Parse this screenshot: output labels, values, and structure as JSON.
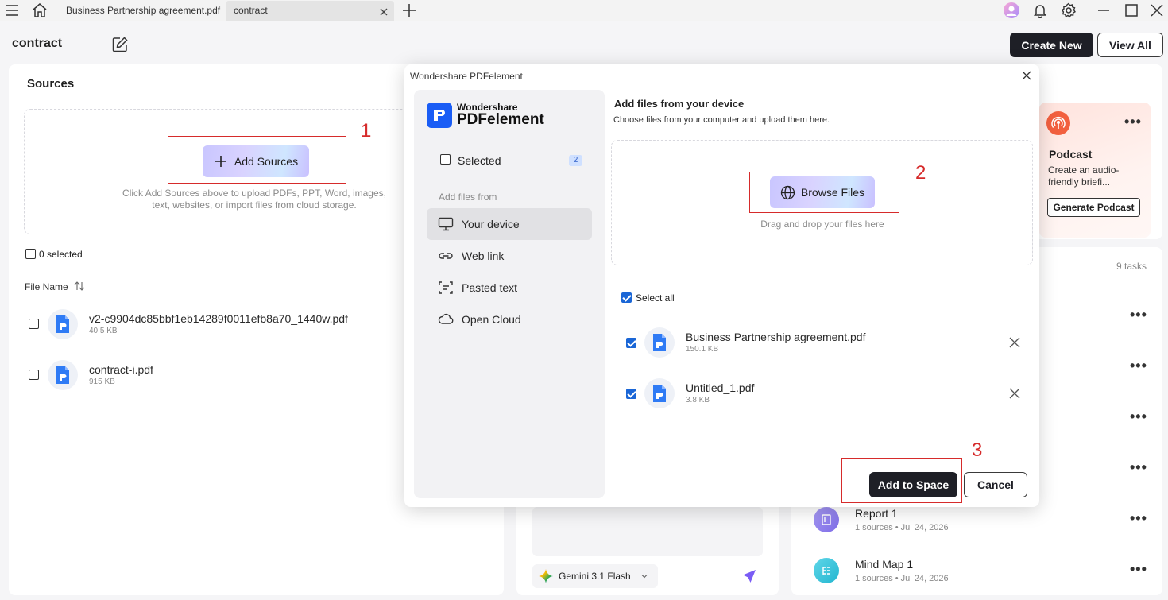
{
  "titlebar": {
    "tabs": [
      {
        "label": "Business Partnership agreement.pdf",
        "active": false
      },
      {
        "label": "contract",
        "active": true
      }
    ],
    "icons": [
      "menu-icon",
      "home-icon",
      "close-tab-icon",
      "new-tab-icon",
      "avatar-icon",
      "bell-icon",
      "gear-icon",
      "minimize-icon",
      "maximize-icon",
      "close-window-icon"
    ]
  },
  "header": {
    "title": "contract",
    "create_new": "Create New",
    "view_all": "View All"
  },
  "sources": {
    "title": "Sources",
    "add_sources": "Add Sources",
    "hint": "Click Add Sources above to upload PDFs, PPT, Word, images, text, websites, or import files from cloud storage.",
    "selected_count": "0 selected",
    "col_file_name": "File Name",
    "files": [
      {
        "name": "v2-c9904dc85bbf1eb14289f0011efb8a70_1440w.pdf",
        "size": "40.5 KB"
      },
      {
        "name": "contract-i.pdf",
        "size": "915 KB"
      }
    ]
  },
  "annotations": {
    "one": "1",
    "two": "2",
    "three": "3"
  },
  "right_panel": {
    "podcast_title": "Podcast",
    "podcast_desc": "Create an audio-friendly briefi...",
    "generate_podcast": "Generate Podcast",
    "tasks_count": "9 tasks",
    "tasks": [
      {
        "title": "Report 1",
        "meta": "1 sources • Jul 24, 2026"
      },
      {
        "title": "Mind Map 1",
        "meta": "1 sources • Jul 24, 2026"
      }
    ]
  },
  "chat": {
    "model": "Gemini 3.1 Flash"
  },
  "modal": {
    "window_title": "Wondershare PDFelement",
    "brand_top": "Wondershare",
    "brand_bottom": "PDFelement",
    "selected_label": "Selected",
    "selected_badge": "2",
    "add_files_from": "Add files from",
    "nav": [
      {
        "label": "Your device",
        "icon": "monitor-icon",
        "active": true
      },
      {
        "label": "Web link",
        "icon": "link-icon",
        "active": false
      },
      {
        "label": "Pasted text",
        "icon": "text-scan-icon",
        "active": false
      },
      {
        "label": "Open Cloud",
        "icon": "cloud-icon",
        "active": false
      }
    ],
    "heading": "Add files from your device",
    "subheading": "Choose files from your computer and upload them here.",
    "browse_files": "Browse Files",
    "drag_hint": "Drag and drop your files here",
    "select_all": "Select all",
    "files": [
      {
        "name": "Business Partnership agreement.pdf",
        "size": "150.1 KB",
        "checked": true
      },
      {
        "name": "Untitled_1.pdf",
        "size": "3.8 KB",
        "checked": true
      }
    ],
    "add_to_space": "Add to Space",
    "cancel": "Cancel"
  },
  "colors": {
    "accent_dark": "#1e1f26",
    "annotation_red": "#d62b2b",
    "checkbox_blue": "#1a66d6",
    "pdf_blue": "#2f7bf5"
  }
}
